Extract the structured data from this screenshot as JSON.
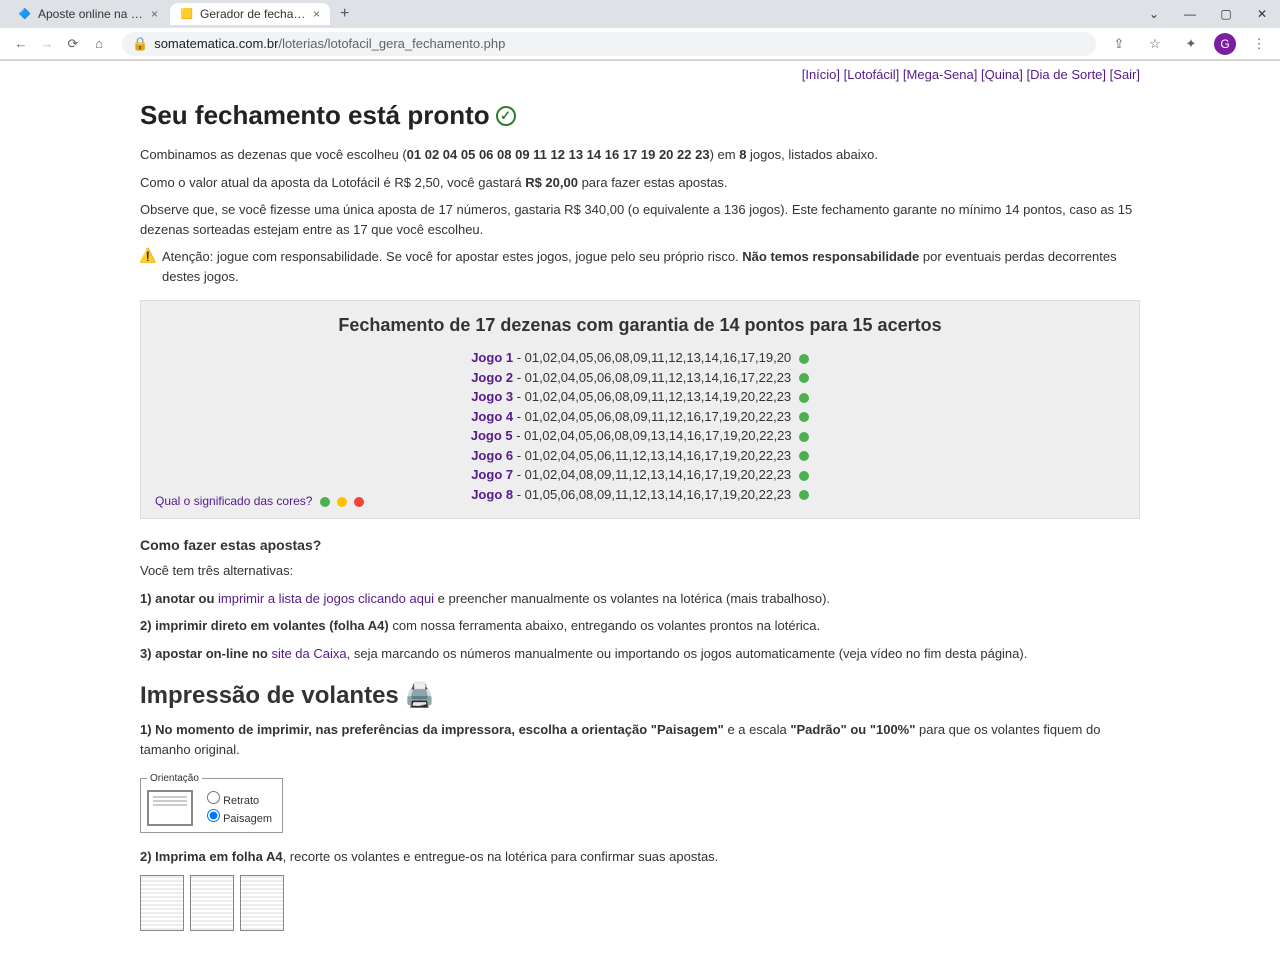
{
  "browser": {
    "tabs": [
      {
        "title": "Aposte online na Lotofácil",
        "favicon": "🔷"
      },
      {
        "title": "Gerador de fechamentos - Sistem",
        "favicon": "🟨"
      }
    ],
    "url_host": "somatematica.com.br",
    "url_path": "/loterias/lotofacil_gera_fechamento.php",
    "avatar_letter": "G"
  },
  "top_links": [
    "[Início]",
    "[Lotofácil]",
    "[Mega-Sena]",
    "[Quina]",
    "[Dia de Sorte]",
    "[Sair]"
  ],
  "heading": "Seu fechamento está pronto",
  "intro": {
    "combine_prefix": "Combinamos as dezenas que você escolheu (",
    "dezenas": "01 02 04 05 06 08 09 11 12 13 14 16 17 19 20 22 23",
    "combine_mid": ") em ",
    "games_count": "8",
    "combine_suffix": " jogos, listados abaixo.",
    "price_prefix": "Como o valor atual da aposta da Lotofácil é R$ 2,50, você gastará ",
    "price_total": "R$ 20,00",
    "price_suffix": " para fazer estas apostas.",
    "observe": "Observe que, se você fizesse uma única aposta de 17 números, gastaria R$ 340,00 (o equivalente a 136 jogos). Este fechamento garante no mínimo 14 pontos, caso as 15 dezenas sorteadas estejam entre as 17 que você escolheu.",
    "warning_prefix": "Atenção: jogue com responsabilidade. Se você for apostar estes jogos, jogue pelo seu próprio risco. ",
    "warning_bold": "Não temos responsabilidade",
    "warning_suffix": " por eventuais perdas decorrentes destes jogos."
  },
  "games_box": {
    "title": "Fechamento de 17 dezenas com garantia de 14 pontos para 15 acertos",
    "games": [
      {
        "label": "Jogo 1",
        "numbers": "01,02,04,05,06,08,09,11,12,13,14,16,17,19,20"
      },
      {
        "label": "Jogo 2",
        "numbers": "01,02,04,05,06,08,09,11,12,13,14,16,17,22,23"
      },
      {
        "label": "Jogo 3",
        "numbers": "01,02,04,05,06,08,09,11,12,13,14,19,20,22,23"
      },
      {
        "label": "Jogo 4",
        "numbers": "01,02,04,05,06,08,09,11,12,16,17,19,20,22,23"
      },
      {
        "label": "Jogo 5",
        "numbers": "01,02,04,05,06,08,09,13,14,16,17,19,20,22,23"
      },
      {
        "label": "Jogo 6",
        "numbers": "01,02,04,05,06,11,12,13,14,16,17,19,20,22,23"
      },
      {
        "label": "Jogo 7",
        "numbers": "01,02,04,08,09,11,12,13,14,16,17,19,20,22,23"
      },
      {
        "label": "Jogo 8",
        "numbers": "01,05,06,08,09,11,12,13,14,16,17,19,20,22,23"
      }
    ],
    "colors_link": "Qual o significado das cores?"
  },
  "how_to": {
    "title": "Como fazer estas apostas?",
    "intro": "Você tem três alternativas:",
    "opt1_prefix": "1) anotar ou ",
    "opt1_link": "imprimir a lista de jogos clicando aqui",
    "opt1_suffix": " e preencher manualmente os volantes na lotérica (mais trabalhoso).",
    "opt2_prefix": "2) imprimir ",
    "opt2_bold": "direto em volantes (folha A4)",
    "opt2_suffix": " com nossa ferramenta abaixo, entregando os volantes prontos na lotérica.",
    "opt3_prefix": "3) apostar on-line no ",
    "opt3_link": "site da Caixa",
    "opt3_suffix": ", seja marcando os números manualmente ou importando os jogos automaticamente (veja vídeo no fim desta página)."
  },
  "print_section": {
    "title": "Impressão de volantes",
    "step1_prefix": "1) No momento de imprimir, nas preferências da impressora, escolha a orientação ",
    "step1_bold1": "\"Paisagem\"",
    "step1_mid": " e a escala ",
    "step1_bold2": "\"Padrão\" ou \"100%\"",
    "step1_suffix": " para que os volantes fiquem do tamanho original.",
    "legend": "Orientação",
    "radio_retrato": "Retrato",
    "radio_paisagem": "Paisagem",
    "step2_prefix": "2) Imprima em folha ",
    "step2_bold": "A4",
    "step2_suffix": ", recorte os volantes e entregue-os na lotérica para confirmar suas apostas."
  }
}
